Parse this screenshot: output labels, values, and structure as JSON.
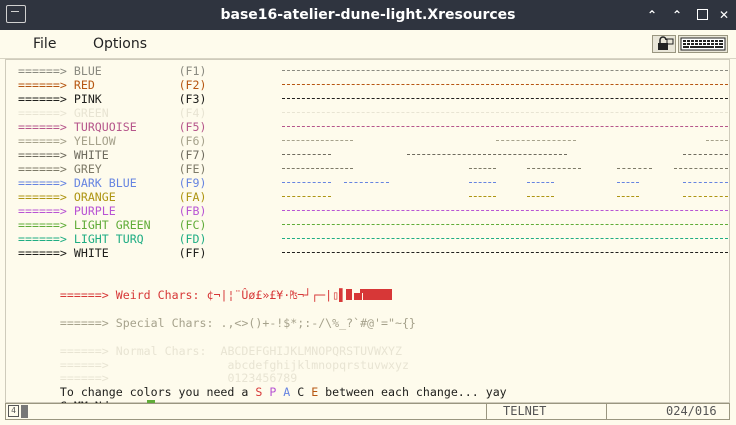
{
  "window": {
    "title": "base16-atelier-dune-light.Xresources"
  },
  "menu": {
    "file": "File",
    "options": "Options"
  },
  "colors": {
    "fg": "#20201d",
    "bg": "#fefbec",
    "blue": "#8a8a80",
    "red": "#d73737",
    "orange": "#b65611",
    "pink": "#20201d",
    "green": "#e8e4d3",
    "magenta": "#b6568b",
    "yellow": "#a6a28c",
    "white": "#6e6b5e",
    "grey": "#7d7a68",
    "darkblue": "#6684e1",
    "dkorange": "#ae9513",
    "purple": "#b854d4",
    "lightgreen": "#60ac39",
    "lightturq": "#1fad83",
    "cursor": "#60ac39"
  },
  "color_lines": [
    {
      "arrow": "======>",
      "name": "BLUE",
      "key": "(F1)",
      "color": "#8a8a80",
      "key_color": "#8a8a80",
      "bar": "#8a8a80",
      "pattern": "full"
    },
    {
      "arrow": "======>",
      "name": "RED",
      "key": "(F2)",
      "color": "#b65611",
      "key_color": "#b65611",
      "bar": "#b65611",
      "pattern": "full"
    },
    {
      "arrow": "======>",
      "name": "PINK",
      "key": "(F3)",
      "color": "#20201d",
      "key_color": "#20201d",
      "bar": "#20201d",
      "pattern": "full"
    },
    {
      "arrow": "======>",
      "name": "GREEN",
      "key": "(F4)",
      "color": "#e8e4d3",
      "key_color": "#e8e4d3",
      "bar": "#e8e4d3",
      "pattern": "full"
    },
    {
      "arrow": "======>",
      "name": "TURQUOISE",
      "key": "(F5)",
      "color": "#b6568b",
      "key_color": "#b6568b",
      "bar": "#b6568b",
      "pattern": "full"
    },
    {
      "arrow": "======>",
      "name": "YELLOW",
      "key": "(F6)",
      "color": "#a6a28c",
      "key_color": "#a6a28c",
      "bar": "#a6a28c",
      "pattern": "a"
    },
    {
      "arrow": "======>",
      "name": "WHITE",
      "key": "(F7)",
      "color": "#6e6b5e",
      "key_color": "#6e6b5e",
      "bar": "#6e6b5e",
      "pattern": "b"
    },
    {
      "arrow": "======>",
      "name": "GREY",
      "key": "(FE)",
      "color": "#7d7a68",
      "key_color": "#7d7a68",
      "bar": "#7d7a68",
      "pattern": "c"
    },
    {
      "arrow": "======>",
      "name": "DARK BLUE",
      "key": "(F9)",
      "color": "#6684e1",
      "key_color": "#6684e1",
      "bar": "#6684e1",
      "pattern": "d"
    },
    {
      "arrow": "======>",
      "name": "ORANGE",
      "key": "(FA)",
      "color": "#ae9513",
      "key_color": "#ae9513",
      "bar": "#ae9513",
      "pattern": "e"
    },
    {
      "arrow": "======>",
      "name": "PURPLE",
      "key": "(FB)",
      "color": "#b854d4",
      "key_color": "#b854d4",
      "bar": "#b854d4",
      "pattern": "full"
    },
    {
      "arrow": "======>",
      "name": "LIGHT GREEN",
      "key": "(FC)",
      "color": "#60ac39",
      "key_color": "#60ac39",
      "bar": "#60ac39",
      "pattern": "full"
    },
    {
      "arrow": "======>",
      "name": "LIGHT TURQ",
      "key": "(FD)",
      "color": "#1fad83",
      "key_color": "#1fad83",
      "bar": "#1fad83",
      "pattern": "full"
    },
    {
      "arrow": "======>",
      "name": "WHITE",
      "key": "(FF)",
      "color": "#20201d",
      "key_color": "#20201d",
      "bar": "#20201d",
      "pattern": "full"
    }
  ],
  "weird": {
    "arrow": "======>",
    "label": "Weird Chars:",
    "chars": "¢¬|¦¨Ûø£»£¥·₧¬┘┌─|▯▌",
    "color": "#d73737"
  },
  "special": {
    "arrow": "======>",
    "label": "Special Chars:",
    "chars": ".,<>()+-!$*;:-/\\%_?`#@'=\"~{}",
    "color": "#a6a28c"
  },
  "normal": {
    "arrow": "======>",
    "label": "Normal Chars:",
    "upper": "ABCDEFGHIJKLMNOPQRSTUVWXYZ",
    "lower": "abcdefghijklmnopqrstuvwxyz",
    "digits": "0123456789",
    "color": "#e8e4d3"
  },
  "hint": {
    "prefix": "To change colors you need a ",
    "s": "S",
    "p": "P",
    "a": "A",
    "c": "C",
    "e": "E",
    "suffix": " between each change... yay"
  },
  "prompt": {
    "text": "CoMMaNd ===>"
  },
  "status": {
    "mode": "TELNET",
    "position": "024/016"
  }
}
